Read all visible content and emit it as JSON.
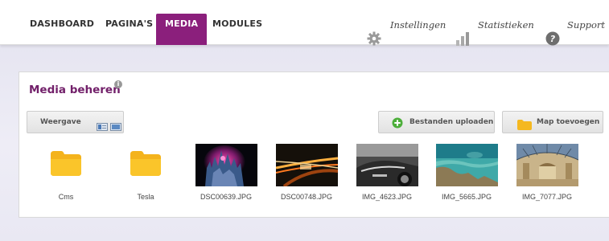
{
  "nav": {
    "items": [
      {
        "label": "DASHBOARD",
        "active": false
      },
      {
        "label": "PAGINA'S",
        "active": false
      },
      {
        "label": "MEDIA",
        "active": true
      },
      {
        "label": "MODULES",
        "active": false
      }
    ],
    "active_color": "#8b1f7c"
  },
  "utility": {
    "settings": {
      "label": "Instellingen",
      "icon": "gear-icon"
    },
    "stats": {
      "label": "Statistieken",
      "icon": "bar-chart-icon"
    },
    "support": {
      "label": "Support",
      "icon": "question-icon"
    }
  },
  "media": {
    "title": "Media beheren",
    "title_color": "#72206a",
    "view_label": "Weergave",
    "upload_label": "Bestanden uploaden",
    "add_folder_label": "Map toevoegen",
    "items": [
      {
        "name": "Cms",
        "kind": "folder"
      },
      {
        "name": "Tesla",
        "kind": "folder"
      },
      {
        "name": "DSC00639.JPG",
        "kind": "image"
      },
      {
        "name": "DSC00748.JPG",
        "kind": "image"
      },
      {
        "name": "IMG_4623.JPG",
        "kind": "image"
      },
      {
        "name": "IMG_5665.JPG",
        "kind": "image"
      },
      {
        "name": "IMG_7077.JPG",
        "kind": "image"
      }
    ]
  }
}
